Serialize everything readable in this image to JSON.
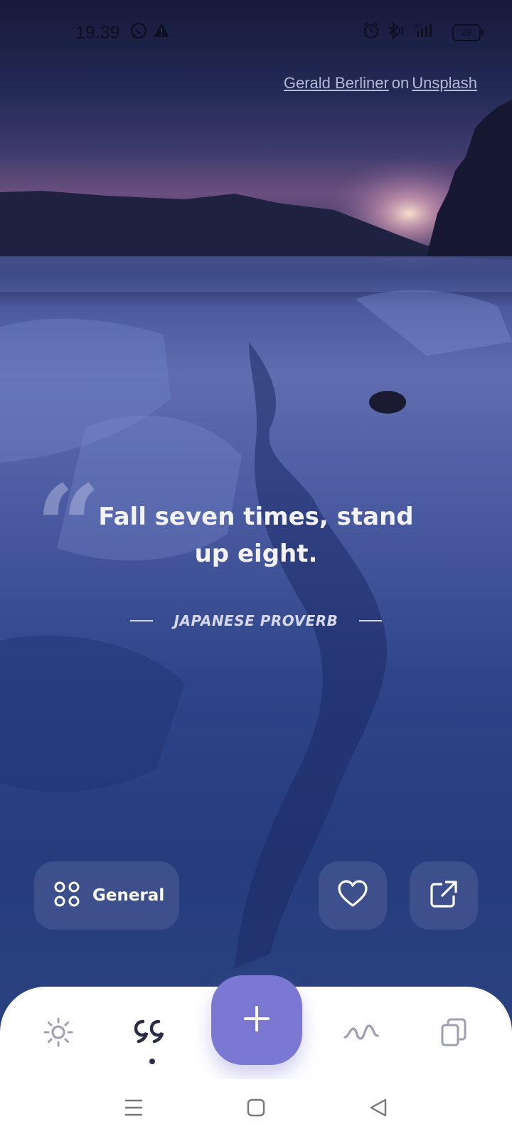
{
  "status_bar": {
    "time": "19.39",
    "battery": "29",
    "icons": [
      "whatsapp-icon",
      "warning-icon",
      "alarm-icon",
      "bluetooth-icon",
      "signal-icon",
      "battery-icon"
    ]
  },
  "photo_credit": {
    "author": "Gerald Berliner",
    "connector": "on",
    "source": "Unsplash"
  },
  "quote": {
    "text": "Fall seven times, stand up eight.",
    "author": "JAPANESE PROVERB"
  },
  "actions": {
    "category_label": "General",
    "icons": [
      "categories-icon",
      "heart-icon",
      "share-icon"
    ]
  },
  "bottom_nav": {
    "items": [
      "sun-icon",
      "quote-icon",
      "add-icon",
      "wave-icon",
      "copy-icon"
    ],
    "active": "quote-icon"
  },
  "system_nav": {
    "items": [
      "menu-icon",
      "home-icon",
      "back-icon"
    ]
  },
  "colors": {
    "accent": "#7b78d4",
    "nav_background": "#ffffff",
    "button_overlay": "rgba(120,130,180,0.28)"
  }
}
